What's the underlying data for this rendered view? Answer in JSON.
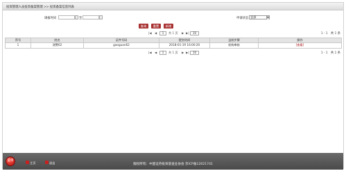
{
  "header": {
    "breadcrumb": "投资管理人员投资备案管理 >> 投资备案信息列表"
  },
  "search": {
    "date_label": "填报时间",
    "date_to": "至",
    "status_label": "申请状态：",
    "status_value": "全部"
  },
  "buttons": {
    "query": "查询",
    "reset": "重置",
    "add": "新增"
  },
  "pager": {
    "first": "|◀",
    "prev": "◀",
    "page_value": "1",
    "page_text": "共 1 页",
    "next": "▶",
    "last": "▶|",
    "size_value": "10",
    "count": "1 - 1　共 1 条"
  },
  "table": {
    "columns": [
      "序号",
      "姓名",
      "证件号码",
      "提交时间",
      "当前步骤",
      "操作"
    ],
    "rows": [
      [
        "1",
        "测警62",
        "gaoguan62",
        "2018-01-19 16:00:20",
        "机构审核",
        "[查看]"
      ]
    ]
  },
  "footer": {
    "start": "菜单",
    "home": "主页",
    "logout": "退出",
    "copyright": "版权所有：中国证券投资基金业协会 京ICP备12021741"
  },
  "colors": {
    "accent": "#a83232",
    "footer": "#555555",
    "header": "#dcdcdc"
  }
}
